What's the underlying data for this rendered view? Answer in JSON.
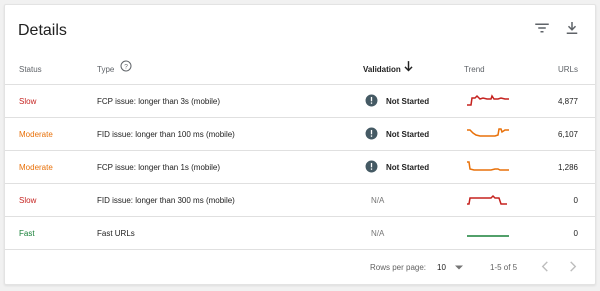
{
  "header": {
    "title": "Details",
    "filter_icon": "filter-icon",
    "download_icon": "download-icon"
  },
  "columns": {
    "status": "Status",
    "type": "Type",
    "validation": "Validation",
    "trend": "Trend",
    "urls": "URLs"
  },
  "rows": [
    {
      "status": "Slow",
      "status_color": "#c5221f",
      "type": "FCP issue: longer than 3s (mobile)",
      "validation": "Not Started",
      "validation_icon": "exclamation-circle-icon",
      "trend_color": "#c5221f",
      "urls": "4,877"
    },
    {
      "status": "Moderate",
      "status_color": "#e8710a",
      "type": "FID issue: longer than 100 ms (mobile)",
      "validation": "Not Started",
      "validation_icon": "exclamation-circle-icon",
      "trend_color": "#e8710a",
      "urls": "6,107"
    },
    {
      "status": "Moderate",
      "status_color": "#e8710a",
      "type": "FCP issue: longer than 1s (mobile)",
      "validation": "Not Started",
      "validation_icon": "exclamation-circle-icon",
      "trend_color": "#e8710a",
      "urls": "1,286"
    },
    {
      "status": "Slow",
      "status_color": "#c5221f",
      "type": "FID issue: longer than 300 ms (mobile)",
      "validation": "N/A",
      "trend_color": "#c5221f",
      "urls": "0"
    },
    {
      "status": "Fast",
      "status_color": "#188038",
      "type": "Fast URLs",
      "validation": "N/A",
      "trend_color": "#188038",
      "urls": "0"
    }
  ],
  "footer": {
    "rows_per_page_label": "Rows per page:",
    "rows_per_page_value": "10",
    "range": "1-5 of 5"
  }
}
